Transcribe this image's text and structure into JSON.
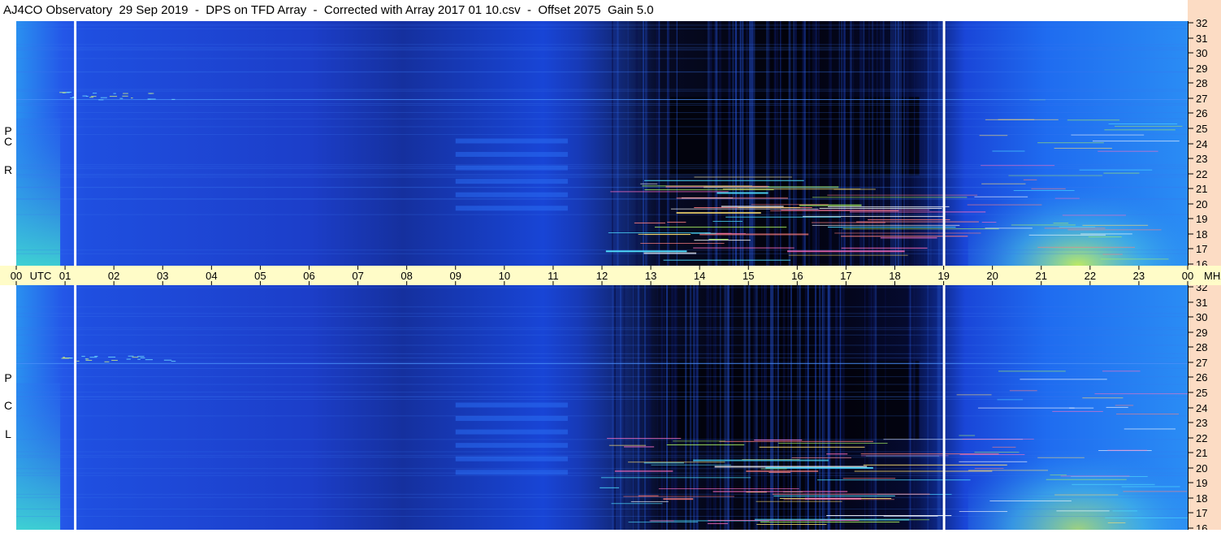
{
  "title": "AJ4CO Observatory  29 Sep 2019  -  DPS on TFD Array  -  Corrected with Array 2017 01 10.csv  -  Offset 2075  Gain 5.0",
  "chart_data": {
    "type": "heatmap",
    "panels": [
      {
        "label": [
          "R",
          "C",
          "P"
        ]
      },
      {
        "label": [
          "L",
          "C",
          "P"
        ]
      }
    ],
    "x_axis": {
      "ticks": [
        "00",
        "01",
        "02",
        "03",
        "04",
        "05",
        "06",
        "07",
        "08",
        "09",
        "10",
        "11",
        "12",
        "13",
        "14",
        "15",
        "16",
        "17",
        "18",
        "19",
        "20",
        "21",
        "22",
        "23",
        "00"
      ],
      "unit_label": "UTC",
      "range_hours": [
        0,
        24
      ]
    },
    "y_axis": {
      "ticks": [
        32,
        31,
        30,
        29,
        28,
        27,
        26,
        25,
        24,
        23,
        22,
        21,
        20,
        19,
        18,
        17,
        16
      ],
      "unit_label": "MHz",
      "range_mhz": [
        16,
        32
      ]
    },
    "time_markers_utc": [
      1.2,
      19.0
    ],
    "colors": {
      "background_low": "#1a3ec8",
      "quiet_dark": "#02020a",
      "mid_blue": "#2a6bf0",
      "high_green": "#a8f060",
      "marker": "#ffffff",
      "axis_band_time": "#fffcc8",
      "axis_band_freq": "#fcdcc4"
    }
  }
}
